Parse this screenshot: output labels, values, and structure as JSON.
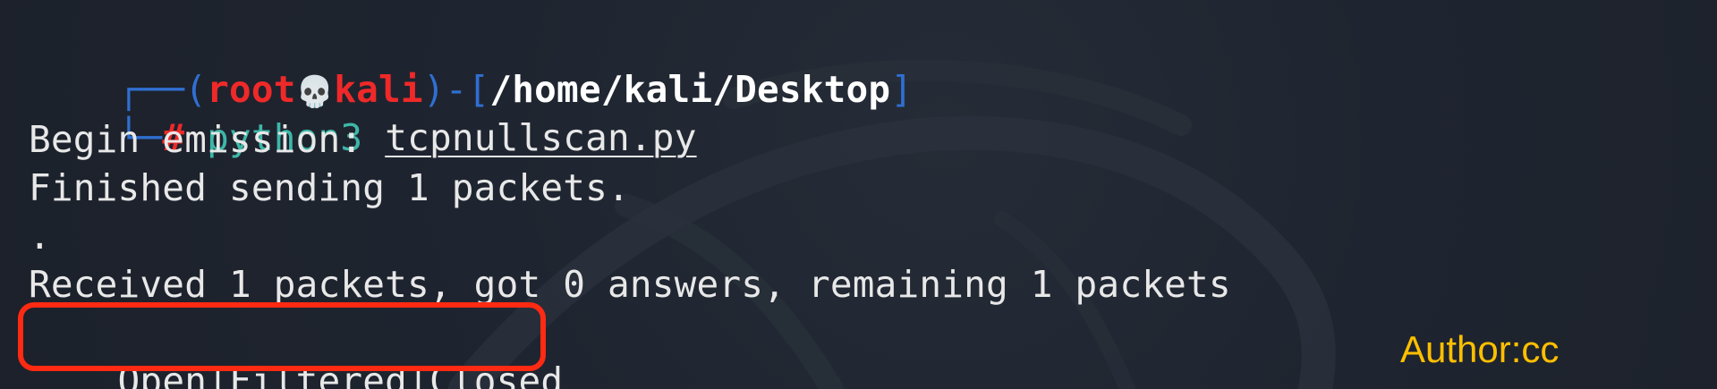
{
  "terminal": {
    "prompt": {
      "open_paren": "(",
      "user": "root",
      "skull": "💀",
      "host": "kali",
      "close_paren": ")",
      "dash": "-",
      "path_open": "[",
      "path": "/home/kali/Desktop",
      "path_close": "]",
      "hash": "#"
    },
    "command": {
      "cmd": "python3",
      "arg": "tcpnullscan.py"
    },
    "output": [
      "Begin emission:",
      "Finished sending 1 packets.",
      ".",
      "Received 1 packets, got 0 answers, remaining 1 packets"
    ],
    "result": {
      "open": "Open",
      "sep1": "|",
      "filtered": "Filtered",
      "sep2": "|",
      "closed": "Closed"
    }
  },
  "watermark": {
    "author": "Author:cc"
  },
  "colors": {
    "background": "#1f2530",
    "prompt_corner": "#2f6fd1",
    "prompt_user": "#ef2929",
    "command": "#3db7a8",
    "text": "#e8e8e8",
    "highlight_box": "#ff2a12",
    "author": "#ffbf00"
  },
  "icons": {
    "skull": "skull-icon"
  }
}
